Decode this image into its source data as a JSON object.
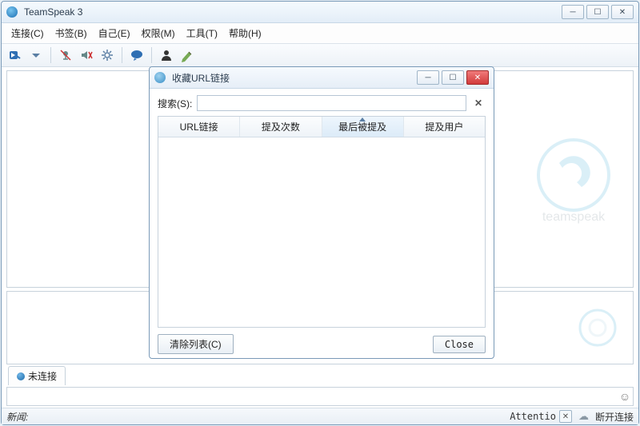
{
  "app": {
    "title": "TeamSpeak 3"
  },
  "menu": {
    "connect": "连接(C)",
    "bookmarks": "书签(B)",
    "self": "自己(E)",
    "permissions": "权限(M)",
    "tools": "工具(T)",
    "help": "帮助(H)"
  },
  "tabs": {
    "not_connected": "未连接"
  },
  "statusbar": {
    "news_label": "新闻:",
    "attention": "Attentio",
    "disconnect": "断开连接"
  },
  "dialog": {
    "title": "收藏URL链接",
    "search_label": "搜索(S):",
    "columns": {
      "url": "URL链接",
      "mentions": "提及次数",
      "last_mentioned": "最后被提及",
      "mention_user": "提及用户"
    },
    "clear_list": "清除列表(C)",
    "close": "Close"
  },
  "chat": {
    "placeholder": ""
  }
}
